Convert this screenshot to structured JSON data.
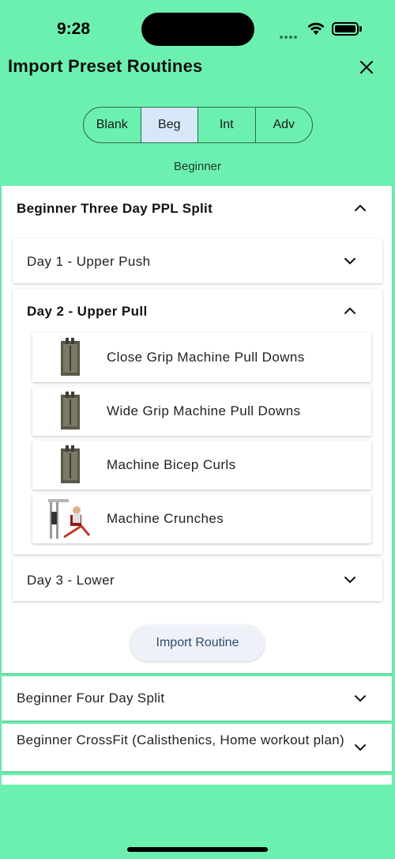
{
  "status_bar": {
    "time": "9:28"
  },
  "header": {
    "title": "Import Preset Routines",
    "close_icon": "close-icon"
  },
  "levels": {
    "options": [
      "Blank",
      "Beg",
      "Int",
      "Adv"
    ],
    "selected": "Beg",
    "selected_label": "Beginner"
  },
  "routines": [
    {
      "name": "Beginner Three Day PPL Split",
      "expanded": true,
      "days": [
        {
          "title": "Day 1 - Upper Push",
          "expanded": false
        },
        {
          "title": "Day 2 - Upper Pull",
          "expanded": true,
          "exercises": [
            {
              "name": "Close Grip Machine Pull Downs",
              "icon": "cable-machine-image"
            },
            {
              "name": "Wide Grip Machine Pull Downs",
              "icon": "cable-machine-image"
            },
            {
              "name": "Machine Bicep Curls",
              "icon": "cable-machine-image"
            },
            {
              "name": "Machine Crunches",
              "icon": "crunch-machine-image"
            }
          ]
        },
        {
          "title": "Day 3 - Lower",
          "expanded": false
        }
      ],
      "import_label": "Import Routine"
    },
    {
      "name": "Beginner Four Day Split",
      "expanded": false
    },
    {
      "name": "Beginner CrossFit (Calisthenics, Home workout plan)",
      "expanded": false
    }
  ],
  "colors": {
    "background": "#6cf0b0",
    "selected_segment": "#d6e8f7",
    "button_text": "#2d4a6e"
  }
}
